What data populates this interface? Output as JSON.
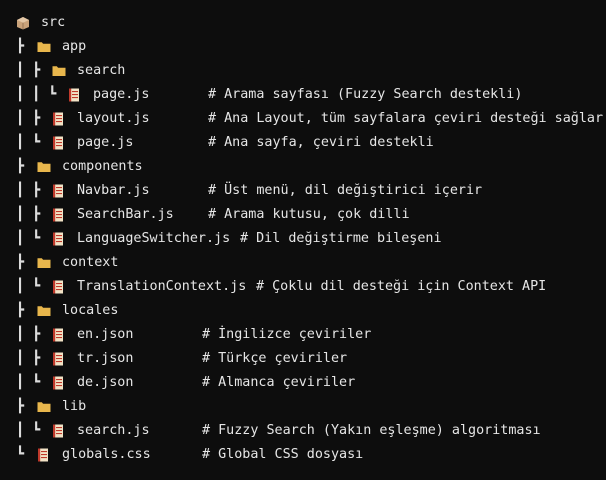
{
  "tree": [
    {
      "name": "src",
      "type": "folder-root",
      "prefix": "",
      "comment": ""
    },
    {
      "name": "app",
      "type": "folder",
      "prefix": "┣",
      "comment": ""
    },
    {
      "name": "search",
      "type": "folder",
      "prefix": "┃ ┣",
      "comment": ""
    },
    {
      "name": "page.js",
      "type": "file",
      "prefix": "┃ ┃ ┗",
      "comment": "# Arama sayfası (Fuzzy Search destekli)"
    },
    {
      "name": "layout.js",
      "type": "file",
      "prefix": "┃ ┣",
      "comment": "# Ana Layout, tüm sayfalara çeviri desteği sağlar"
    },
    {
      "name": "page.js",
      "type": "file",
      "prefix": "┃ ┗",
      "comment": "# Ana sayfa, çeviri destekli"
    },
    {
      "name": "components",
      "type": "folder",
      "prefix": "┣",
      "comment": ""
    },
    {
      "name": "Navbar.js",
      "type": "file",
      "prefix": "┃ ┣",
      "comment": "# Üst menü, dil değiştirici içerir"
    },
    {
      "name": "SearchBar.js",
      "type": "file",
      "prefix": "┃ ┣",
      "comment": "# Arama kutusu, çok dilli"
    },
    {
      "name": "LanguageSwitcher.js",
      "type": "file",
      "prefix": "┃ ┗",
      "comment": "# Dil değiştirme bileşeni"
    },
    {
      "name": "context",
      "type": "folder",
      "prefix": "┣",
      "comment": ""
    },
    {
      "name": "TranslationContext.js",
      "type": "file",
      "prefix": "┃ ┗",
      "comment": "# Çoklu dil desteği için Context API"
    },
    {
      "name": "locales",
      "type": "folder",
      "prefix": "┣",
      "comment": ""
    },
    {
      "name": "en.json",
      "type": "file",
      "prefix": "┃ ┣",
      "comment": "# İngilizce çeviriler"
    },
    {
      "name": "tr.json",
      "type": "file",
      "prefix": "┃ ┣",
      "comment": "# Türkçe çeviriler"
    },
    {
      "name": "de.json",
      "type": "file",
      "prefix": "┃ ┗",
      "comment": "# Almanca çeviriler"
    },
    {
      "name": "lib",
      "type": "folder",
      "prefix": "┣",
      "comment": ""
    },
    {
      "name": "search.js",
      "type": "file",
      "prefix": "┃ ┗",
      "comment": "# Fuzzy Search (Yakın eşleşme) algoritması"
    },
    {
      "name": "globals.css",
      "type": "file",
      "prefix": "┗",
      "comment": "# Global CSS dosyası"
    }
  ],
  "colors": {
    "background": "#0d0d0d",
    "text": "#e6e6e6",
    "folder": "#e8b64c",
    "file_body": "#f2e3c6",
    "file_lines": "#c0392b",
    "root_box": "#c9a27a"
  }
}
